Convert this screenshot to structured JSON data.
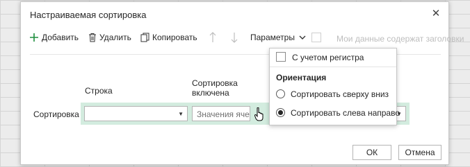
{
  "dialog": {
    "title": "Настраиваемая сортировка",
    "close_glyph": "✕"
  },
  "toolbar": {
    "add_label": "Добавить",
    "delete_label": "Удалить",
    "copy_label": "Копировать",
    "params_label": "Параметры",
    "headers_label": "Мои данные содержат заголовки"
  },
  "columns": {
    "row_header": "Строка",
    "sort_header_line1": "Сортировка",
    "sort_header_line2": "включена"
  },
  "sort_row": {
    "label": "Сортировка",
    "row_value": "",
    "sort_on_value": "Значения ячеек",
    "order_value": ""
  },
  "menu": {
    "case_sensitive_label": "С учетом регистра",
    "orientation_heading": "Ориентация",
    "options": [
      {
        "label": "Сортировать сверху вниз",
        "selected": false
      },
      {
        "label": "Сортировать слева направо",
        "selected": true
      }
    ]
  },
  "buttons": {
    "ok": "ОК",
    "cancel": "Отмена"
  },
  "colors": {
    "accent_green": "#1e8e3e",
    "row_highlight": "#d3ecdf"
  },
  "icons": [
    "plus-icon",
    "trash-icon",
    "copy-icon",
    "arrow-up-icon",
    "arrow-down-icon",
    "chevron-down-icon",
    "close-icon",
    "pointer-cursor-icon"
  ]
}
